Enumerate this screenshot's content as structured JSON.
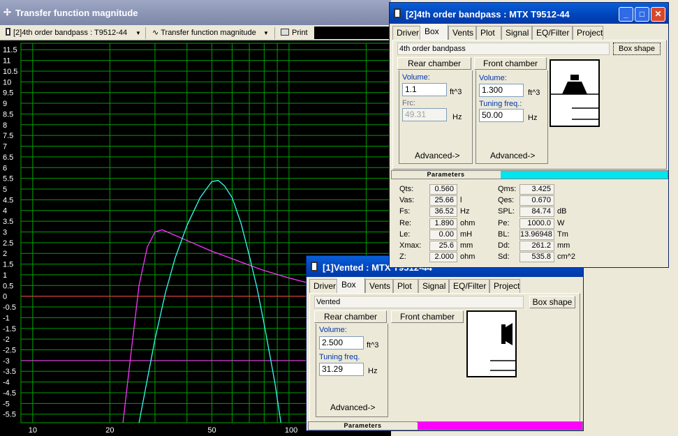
{
  "main_window": {
    "title": "Transfer function magnitude",
    "toolbar": {
      "project_select": "[2]4th order bandpass : T9512-44",
      "view_select": "Transfer function magnitude",
      "print_label": "Print"
    }
  },
  "chart_data": {
    "type": "line",
    "y_ticks": [
      "11.5",
      "11",
      "10.5",
      "10",
      "9.5",
      "9",
      "8.5",
      "8",
      "7.5",
      "7",
      "6.5",
      "6",
      "5.5",
      "5",
      "4.5",
      "4",
      "3.5",
      "3",
      "2.5",
      "2",
      "1.5",
      "1",
      "0.5",
      "0",
      "-0.5",
      "-1",
      "-1.5",
      "-2",
      "-2.5",
      "-3",
      "-3.5",
      "-4",
      "-4.5",
      "-5",
      "-5.5"
    ],
    "x_ticks": [
      "10",
      "20",
      "50",
      "100"
    ],
    "xscale": "log",
    "ylim": [
      -5.9,
      11.8
    ],
    "xlim": [
      9,
      250
    ],
    "grid": true,
    "series": [
      {
        "color": "#ff33ff",
        "points": [
          [
            22.5,
            -5.9
          ],
          [
            24,
            -3
          ],
          [
            26,
            0.5
          ],
          [
            28,
            2.3
          ],
          [
            30,
            3
          ],
          [
            32,
            3.1
          ],
          [
            35,
            2.9
          ],
          [
            40,
            2.6
          ],
          [
            50,
            2.1
          ],
          [
            60,
            1.75
          ],
          [
            70,
            1.45
          ],
          [
            80,
            1.2
          ],
          [
            100,
            0.85
          ],
          [
            130,
            0.5
          ],
          [
            160,
            0.25
          ],
          [
            200,
            0.05
          ],
          [
            250,
            -0.1
          ]
        ]
      },
      {
        "color": "#33ffee",
        "points": [
          [
            26,
            -5.9
          ],
          [
            30,
            -2
          ],
          [
            33,
            0.2
          ],
          [
            36,
            1.8
          ],
          [
            40,
            3.3
          ],
          [
            45,
            4.6
          ],
          [
            50,
            5.35
          ],
          [
            53,
            5.4
          ],
          [
            56,
            5.15
          ],
          [
            60,
            4.6
          ],
          [
            65,
            3.4
          ],
          [
            70,
            1.9
          ],
          [
            75,
            0.4
          ],
          [
            80,
            -1.3
          ],
          [
            88,
            -4
          ],
          [
            93,
            -5.9
          ]
        ]
      }
    ],
    "ref_lines": [
      {
        "y": 0,
        "color": "#ff3344"
      },
      {
        "y": -3,
        "color": "#ff33ff"
      }
    ]
  },
  "dialog_bandpass": {
    "title": "[2]4th order bandpass : MTX T9512-44",
    "tabs": [
      "Driver",
      "Box",
      "Vents",
      "Plot",
      "Signal",
      "EQ/Filter",
      "Project"
    ],
    "active_tab": "Box",
    "box_name": "4th order bandpass",
    "box_shape_button": "Box shape",
    "rear_chamber_button": "Rear chamber",
    "front_chamber_button": "Front chamber",
    "rear": {
      "volume_label": "Volume:",
      "volume": "1.1",
      "volume_unit": "ft^3",
      "frc_label": "Frc:",
      "frc": "49.31",
      "frc_unit": "Hz",
      "advanced": "Advanced->"
    },
    "front": {
      "volume_label": "Volume:",
      "volume": "1.300",
      "volume_unit": "ft^3",
      "tuning_label": "Tuning freq.:",
      "tuning": "50.00",
      "tuning_unit": "Hz",
      "advanced": "Advanced->"
    },
    "parameters_label": "Parameters",
    "parameters_color": "#00e5ee",
    "params_left": [
      {
        "name": "Qts:",
        "value": "0.560",
        "unit": ""
      },
      {
        "name": "Vas:",
        "value": "25.66",
        "unit": "l"
      },
      {
        "name": "Fs:",
        "value": "36.52",
        "unit": "Hz"
      },
      {
        "name": "Re:",
        "value": "1.890",
        "unit": "ohm"
      },
      {
        "name": "Le:",
        "value": "0.00",
        "unit": "mH"
      },
      {
        "name": "Xmax:",
        "value": "25.6",
        "unit": "mm"
      },
      {
        "name": "Z:",
        "value": "2.000",
        "unit": "ohm"
      }
    ],
    "params_right": [
      {
        "name": "Qms:",
        "value": "3.425",
        "unit": ""
      },
      {
        "name": "Qes:",
        "value": "0.670",
        "unit": ""
      },
      {
        "name": "SPL:",
        "value": "84.74",
        "unit": "dB"
      },
      {
        "name": "Pe:",
        "value": "1000.0",
        "unit": "W"
      },
      {
        "name": "BL:",
        "value": "13.96948",
        "unit": "Tm"
      },
      {
        "name": "Dd:",
        "value": "261.2",
        "unit": "mm"
      },
      {
        "name": "Sd:",
        "value": "535.8",
        "unit": "cm^2"
      }
    ]
  },
  "dialog_vented": {
    "title": "[1]Vented : MTX T9512-44",
    "tabs": [
      "Driver",
      "Box",
      "Vents",
      "Plot",
      "Signal",
      "EQ/Filter",
      "Project"
    ],
    "active_tab": "Box",
    "box_name": "Vented",
    "box_shape_button": "Box shape",
    "rear_chamber_button": "Rear chamber",
    "front_chamber_button": "Front chamber",
    "volume_label": "Volume:",
    "volume": "2.500",
    "volume_unit": "ft^3",
    "tuning_label": "Tuning freq.",
    "tuning": "31.29",
    "tuning_unit": "Hz",
    "advanced": "Advanced->",
    "parameters_label": "Parameters",
    "parameters_color": "#ff00ff"
  }
}
